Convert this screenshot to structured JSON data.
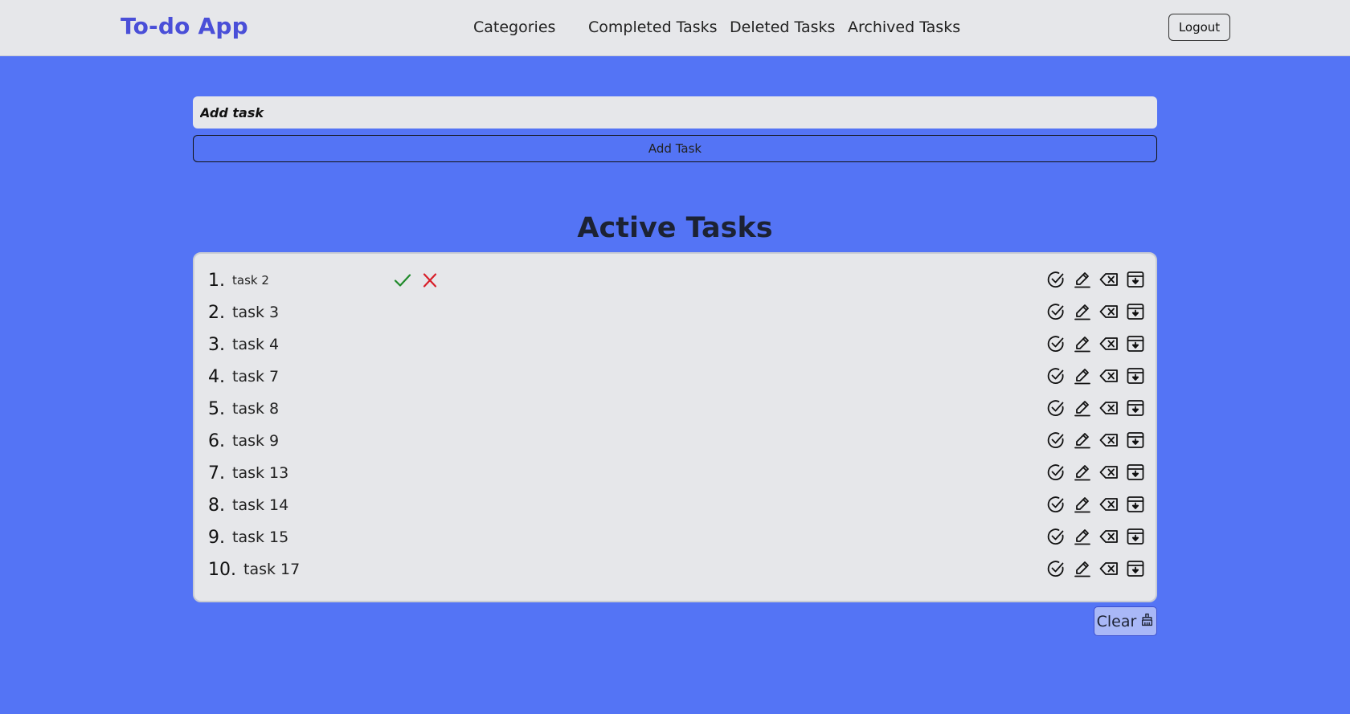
{
  "app": {
    "brand": "To-do App"
  },
  "nav": {
    "links": [
      "Categories",
      "Completed Tasks",
      "Deleted Tasks",
      "Archived Tasks"
    ],
    "logout_label": "Logout"
  },
  "add": {
    "placeholder": "Add task",
    "button_label": "Add Task"
  },
  "section": {
    "title": "Active Tasks"
  },
  "tasks": [
    {
      "num": "1.",
      "text": "task 2",
      "editing": true
    },
    {
      "num": "2.",
      "text": "task 3"
    },
    {
      "num": "3.",
      "text": "task 4"
    },
    {
      "num": "4.",
      "text": "task 7"
    },
    {
      "num": "5.",
      "text": "task 8"
    },
    {
      "num": "6.",
      "text": "task 9"
    },
    {
      "num": "7.",
      "text": "task 13"
    },
    {
      "num": "8.",
      "text": "task 14"
    },
    {
      "num": "9.",
      "text": "task 15"
    },
    {
      "num": "10.",
      "text": "task 17"
    }
  ],
  "row_actions": [
    "check-circle-icon",
    "pencil-icon",
    "backspace-icon",
    "archive-icon"
  ],
  "confirm_icons": [
    "checkmark-icon",
    "x-mark-icon"
  ],
  "clear": {
    "label": "Clear",
    "icon": "broom-icon"
  },
  "colors": {
    "background": "#5474f5",
    "brand": "#4a4fd8",
    "panel": "#e6e7ea",
    "confirm": "#1f8a2a",
    "cancel": "#d81f2a"
  }
}
